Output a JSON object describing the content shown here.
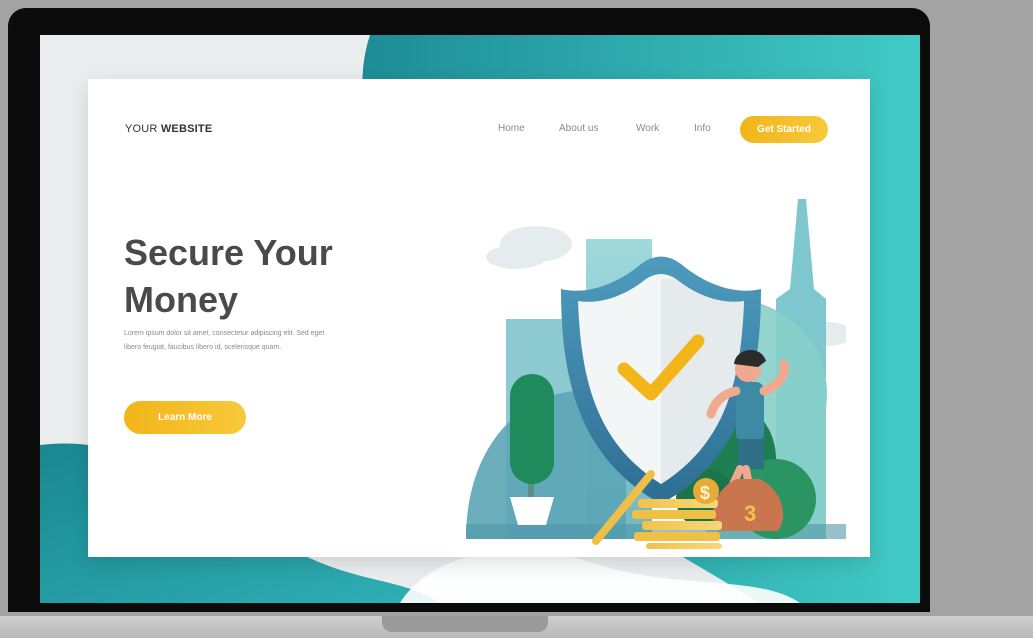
{
  "site": {
    "logo_light": "YOUR ",
    "logo_bold": "WEBSITE"
  },
  "nav": {
    "items": [
      "Home",
      "About us",
      "Work",
      "Info"
    ],
    "cta_label": "Get Started"
  },
  "hero": {
    "headline_line1": "Secure Your",
    "headline_line2": "Money",
    "body": "Lorem ipsum dolor sit amet, consectetur adipiscing elit. Sed eget libero feugiat, faucibus libero id, scelerisque quam.",
    "button_label": "Learn More"
  },
  "illustration": {
    "coin_symbol": "$",
    "bag_symbol": "3"
  },
  "colors": {
    "accent_yellow": "#f4bd24",
    "teal_dark": "#1f8f97",
    "teal_light": "#3ec9c4",
    "shield_blue": "#3f87a8",
    "text_dark": "#4a4a4a",
    "text_muted": "#8a8a8a"
  }
}
